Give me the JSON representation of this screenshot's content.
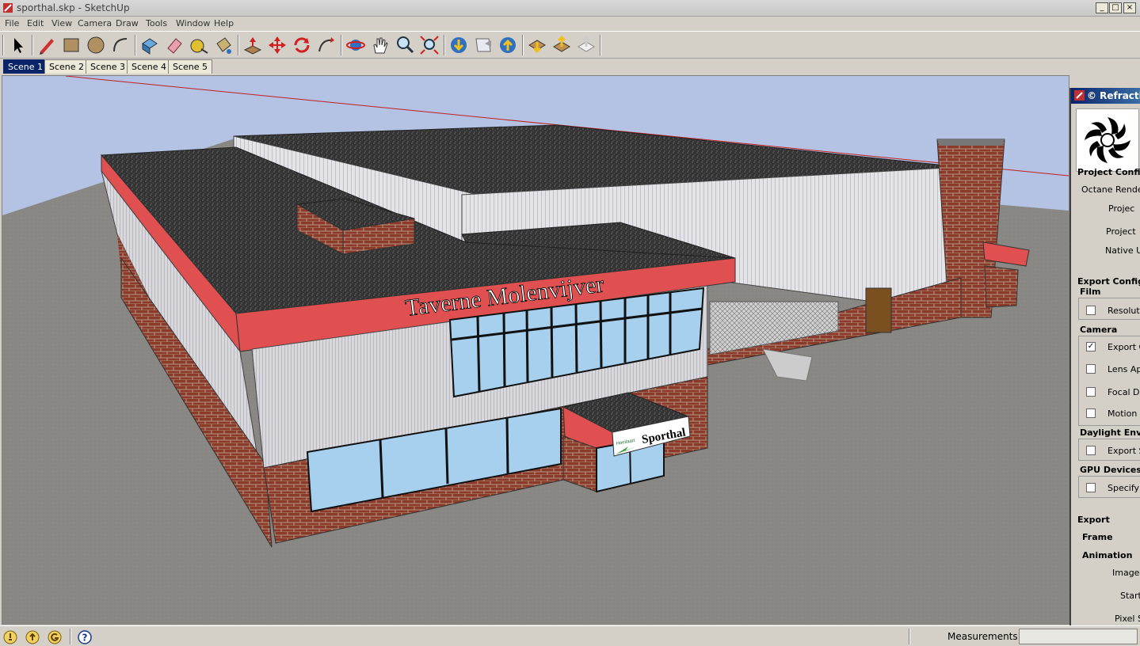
{
  "window": {
    "title": "sporthal.skp - SketchUp",
    "minimize": "_",
    "maximize": "□",
    "close": "×"
  },
  "menu": [
    "File",
    "Edit",
    "View",
    "Camera",
    "Draw",
    "Tools",
    "Window",
    "Help"
  ],
  "toolbar": {
    "tools": [
      "select-icon",
      "pencil-icon",
      "rectangle-icon",
      "circle-icon",
      "arc-icon",
      "make-component-icon",
      "eraser-icon",
      "tape-measure-icon",
      "paint-bucket-icon",
      "push-pull-icon",
      "move-icon",
      "rotate-icon",
      "follow-me-icon",
      "orbit-icon",
      "pan-icon",
      "zoom-icon",
      "zoom-extents-icon",
      "get-models-icon",
      "share-model-icon",
      "upload-icon",
      "import-icon",
      "export-icon",
      "send-icon"
    ]
  },
  "scenes": [
    "Scene 1",
    "Scene 2",
    "Scene 3",
    "Scene 4",
    "Scene 5"
  ],
  "active_scene": "Scene 1",
  "model": {
    "sign_main": "Taverne Molenvijver",
    "sign_small": "Sporthal",
    "sign_logo": "Hoeilaart"
  },
  "panel": {
    "title": "© Refractive",
    "project_configuration": "Project Configu",
    "octane_render": "Octane Render",
    "project1": "Projec",
    "project2": "Project",
    "native_units": "Native Ur",
    "export_configuration": "Export Configu",
    "film": "Film",
    "resolution": "Resolutio",
    "camera": "Camera",
    "export_camera": "Export C",
    "lens_aperture": "Lens Ape",
    "focal_depth": "Focal Dep",
    "motion_blur": "Motion Bl",
    "daylight_environment": "Daylight Envir",
    "export_sun": "Export Sc",
    "gpu_devices": "GPU Devices",
    "specify_gpu": "Specify G",
    "export": "Export",
    "frame": "Frame",
    "animation": "Animation",
    "image": "Image C",
    "start": "Start",
    "pixel_samples": "Pixel Sa",
    "check_mark": "✓"
  },
  "status": {
    "measurements_label": "Measurements",
    "help_glyph": "?"
  },
  "colors": {
    "sky": "#b4c2e4",
    "ground": "#8a8884",
    "roof": "#3a3a3a",
    "brick": "#8b3a2a",
    "fascia": "#e05050",
    "glass": "#a6d0ee",
    "siding": "#d8d8dc",
    "accent": "#0a246a"
  }
}
